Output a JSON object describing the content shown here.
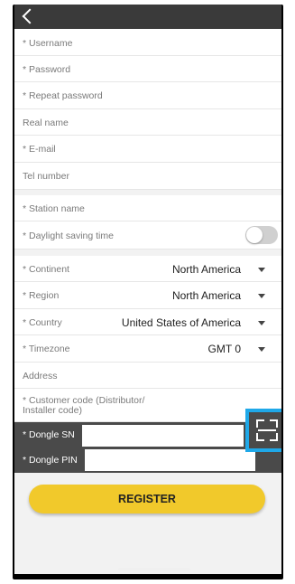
{
  "form": {
    "username": "* Username",
    "password": "* Password",
    "repeat_password": "* Repeat password",
    "real_name": "Real name",
    "email": "* E-mail",
    "tel": "Tel number",
    "station_name": "* Station name",
    "daylight_saving": "* Daylight saving time",
    "continent_label": "* Continent",
    "continent_value": "North America",
    "region_label": "* Region",
    "region_value": "North America",
    "country_label": "* Country",
    "country_value": "United States of America",
    "timezone_label": "* Timezone",
    "timezone_value": "GMT 0",
    "address": "Address",
    "customer_code_line1": "* Customer code (Distributor/",
    "customer_code_line2": "Installer code)",
    "dongle_sn": "* Dongle SN",
    "dongle_pin": "* Dongle PIN",
    "register": "REGISTER"
  },
  "icons": {
    "back": "chevron-left-icon",
    "scan": "scan-frame-icon",
    "dropdown": "caret-down-icon"
  },
  "colors": {
    "accent_button": "#f1c92b",
    "highlight_frame": "#1fa8e8",
    "dark_bar": "#4a4a4a"
  }
}
